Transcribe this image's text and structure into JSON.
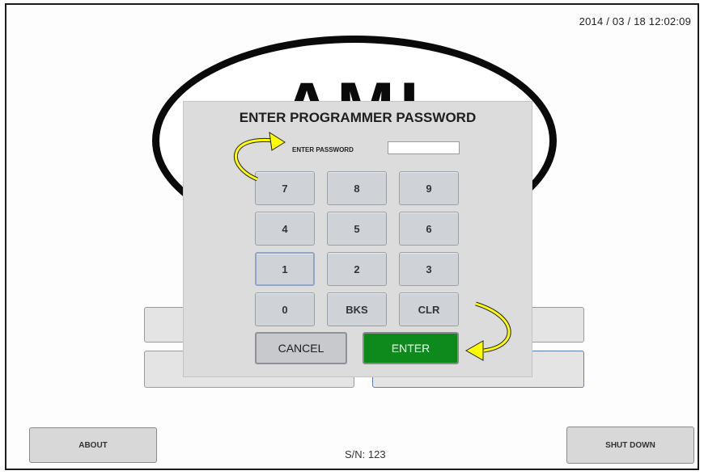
{
  "status": {
    "datetime": "2014 / 03 / 18   12:02:09",
    "serial": "S/N: 123"
  },
  "footer": {
    "about_label": "ABOUT",
    "shutdown_label": "SHUT DOWN"
  },
  "logo": {
    "text": "AML"
  },
  "dialog": {
    "title": "ENTER PROGRAMMER PASSWORD",
    "password_label": "ENTER PASSWORD",
    "password_value": "",
    "keys": [
      "7",
      "8",
      "9",
      "4",
      "5",
      "6",
      "1",
      "2",
      "3",
      "0",
      "BKS",
      "CLR"
    ],
    "cancel_label": "CANCEL",
    "enter_label": "ENTER"
  },
  "colors": {
    "enter_green": "#0e8a1c",
    "arrow_yellow": "#ffff00",
    "dialog_bg": "#dcdcdc"
  },
  "annotations": [
    "curved-arrow-icon",
    "curved-arrow-icon"
  ]
}
